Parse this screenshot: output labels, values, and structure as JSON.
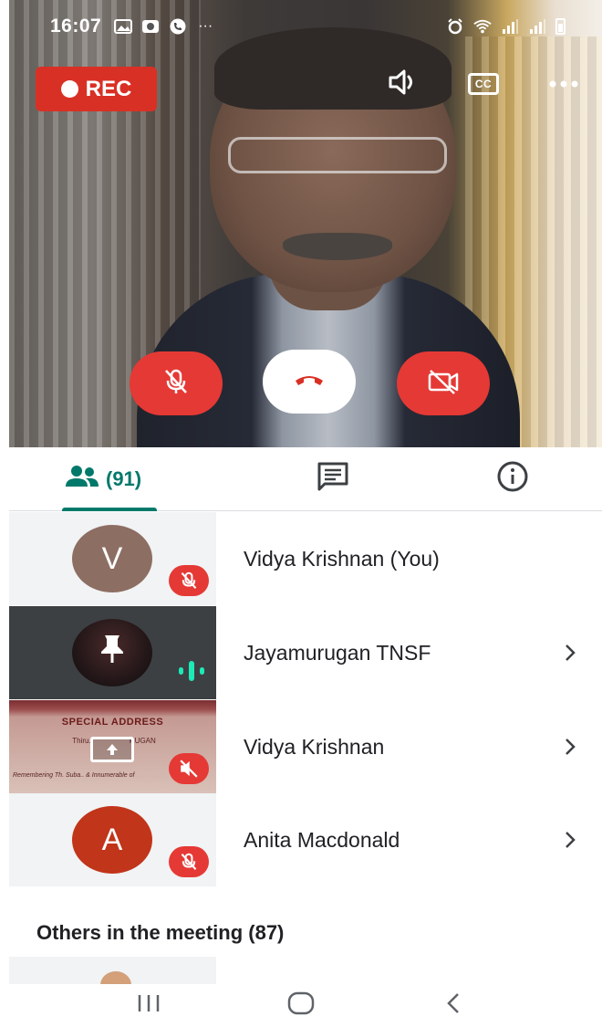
{
  "status_bar": {
    "time": "16:07",
    "left_icons": [
      "image-icon",
      "gallery-icon",
      "phone-icon",
      "more-dots-icon"
    ],
    "overflow": "···",
    "right_icons": [
      "alarm-icon",
      "wifi-icon",
      "signal-icon",
      "signal-icon",
      "battery-icon"
    ]
  },
  "video": {
    "rec_label": "REC",
    "top_controls": [
      "speaker-icon",
      "captions-icon",
      "more-options-icon"
    ],
    "captions_label": "CC",
    "call_controls": [
      "mic-off-icon",
      "end-call-icon",
      "camera-off-icon"
    ],
    "colors": {
      "record": "#d93025",
      "control_red": "#e53935",
      "end_call_icon": "#d93025"
    }
  },
  "tabs": [
    {
      "id": "people",
      "label": "(91)",
      "icon": "people-icon",
      "selected": true
    },
    {
      "id": "chat",
      "label": "",
      "icon": "chat-icon",
      "selected": false
    },
    {
      "id": "info",
      "label": "",
      "icon": "info-icon",
      "selected": false
    }
  ],
  "accent": "#00796b",
  "participants": [
    {
      "name": "Vidya Krishnan (You)",
      "avatar_letter": "V",
      "avatar_color": "#8d6e63",
      "status": "muted",
      "chevron": false
    },
    {
      "name": "Jayamurugan TNSF",
      "status": "speaking",
      "pinned_icon": "pin-icon",
      "chevron": true
    },
    {
      "name": "Vidya Krishnan",
      "status": "presenting-muted",
      "chevron": true,
      "slide": {
        "title": "SPECIAL ADDRESS",
        "subtitle": "Thiru.",
        "subtitle_end": "RUGAN",
        "footer": "Remembering Th. Suba.. & Innumerable of"
      }
    },
    {
      "name": "Anita Macdonald",
      "avatar_letter": "A",
      "avatar_color": "#c1351a",
      "status": "muted",
      "chevron": true
    }
  ],
  "others": {
    "label": "Others in the meeting (87)"
  },
  "nav_bar": [
    "recent-apps-icon",
    "home-icon",
    "back-icon"
  ]
}
